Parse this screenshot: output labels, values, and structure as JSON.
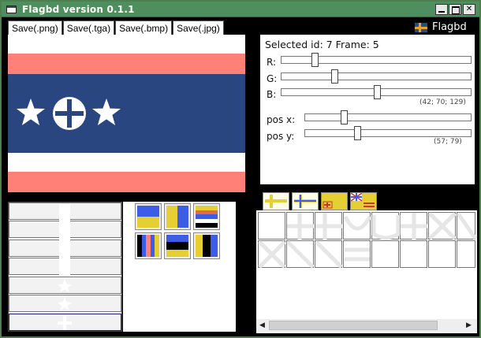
{
  "window": {
    "title": "Flagbd version 0.1.1"
  },
  "toolbar": {
    "buttons": [
      {
        "id": "save-png",
        "label": "Save(.png)"
      },
      {
        "id": "save-tga",
        "label": "Save(.tga)"
      },
      {
        "id": "save-bmp",
        "label": "Save(.bmp)"
      },
      {
        "id": "save-jpg",
        "label": "Save(.jpg)"
      }
    ]
  },
  "brand": {
    "name": "Flagbd",
    "icon": "cross-flag-icon"
  },
  "colors": {
    "pink": "#ff8077",
    "navy": "#2a4681",
    "white": "#ffffff",
    "yellow": "#e6cf33",
    "blue": "#3d5ce8",
    "black": "#000000",
    "accent_orange": "#f0a020",
    "titlebar": "#4f8f5f"
  },
  "selection": {
    "text": "Selected id: 7 Frame: 5"
  },
  "color_sliders": {
    "r": {
      "label": "R:",
      "value": 42,
      "max": 255
    },
    "g": {
      "label": "G:",
      "value": 70,
      "max": 255
    },
    "b": {
      "label": "B:",
      "value": 129,
      "max": 255
    },
    "readout": "(42; 70; 129)"
  },
  "pos_sliders": {
    "x": {
      "label": "pos  x:",
      "value": 57,
      "max": 255
    },
    "y": {
      "label": "pos  y:",
      "value": 79,
      "max": 255
    },
    "readout": "(57; 79)"
  },
  "stack_list": {
    "items": [
      {
        "name": "layer-blank"
      },
      {
        "name": "layer-bar"
      },
      {
        "name": "layer-bar"
      },
      {
        "name": "layer-bar"
      },
      {
        "name": "layer-star"
      },
      {
        "name": "layer-star"
      },
      {
        "name": "layer-cross",
        "selected": true
      }
    ]
  },
  "layout_presets": [
    {
      "name": "two-color-horizontal"
    },
    {
      "name": "two-color-vertical"
    },
    {
      "name": "multi-stripe-horizontal"
    },
    {
      "name": "multi-stripe-vertical"
    },
    {
      "name": "tricolor-horizontal"
    },
    {
      "name": "tricolor-vertical"
    }
  ],
  "element_tabs": [
    {
      "name": "cross-tab",
      "icon": "cross-icon"
    },
    {
      "name": "nordic-cross-tab",
      "icon": "nordic-cross-icon"
    },
    {
      "name": "canton-tab",
      "icon": "canton-icon"
    },
    {
      "name": "union-tab",
      "icon": "union-jack-icon"
    }
  ]
}
